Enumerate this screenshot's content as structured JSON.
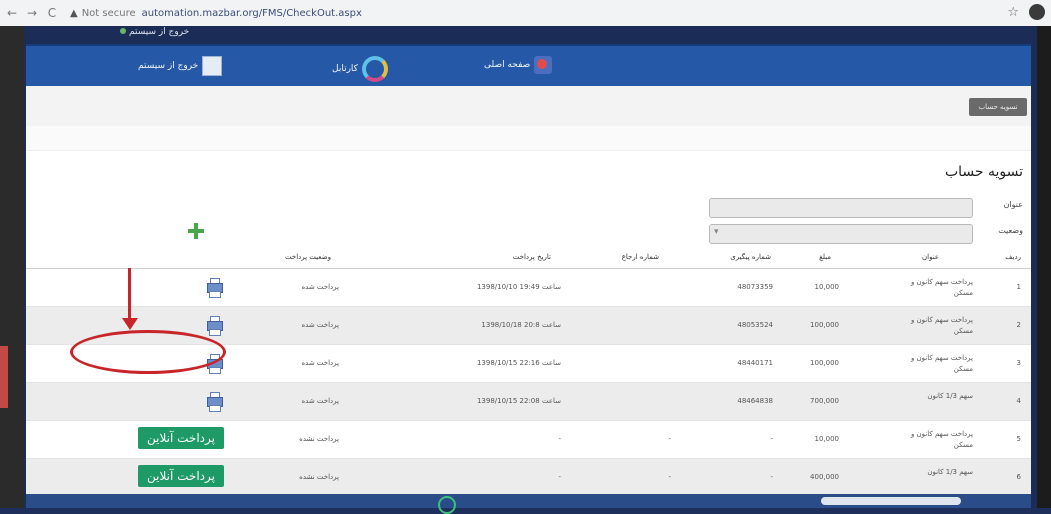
{
  "browser": {
    "back": "←",
    "forward": "→",
    "reload": "C",
    "warning_icon": "▲",
    "not_secure": "Not secure",
    "url": "automation.mazbar.org/FMS/CheckOut.aspx",
    "star": "☆"
  },
  "top_user": "خروج از سیستم",
  "nav": {
    "item_home": "صفحه اصلی",
    "item_cartable": "کارتابل",
    "item_logout": "خروج از سیستم"
  },
  "sub_tab": "تسویه حساب",
  "page_title": "تسویه حساب",
  "filters": {
    "label_title": "عنوان",
    "label_status": "وضعیت",
    "status_marker": "▾"
  },
  "table": {
    "headers": {
      "idx": "ردیف",
      "title": "عنوان",
      "amount": "مبلغ",
      "tracking": "شماره پیگیری",
      "payment_no": "شماره ارجاع",
      "date": "تاریخ پرداخت",
      "state": "وضعیت پرداخت"
    },
    "rows": [
      {
        "idx": "1",
        "title": "پرداخت سهم کانون و مسکن",
        "amount": "10,000",
        "tracking": "48073359",
        "payment_no": "",
        "date": "1398/10/10 ساعت 19:49",
        "state": "پرداخت شده",
        "action": "print"
      },
      {
        "idx": "2",
        "title": "پرداخت سهم کانون و مسکن",
        "amount": "100,000",
        "tracking": "48053524",
        "payment_no": "",
        "date": "1398/10/18 ساعت 20:8",
        "state": "پرداخت شده",
        "action": "print"
      },
      {
        "idx": "3",
        "title": "پرداخت سهم کانون و مسکن",
        "amount": "100,000",
        "tracking": "48440171",
        "payment_no": "",
        "date": "1398/10/15 ساعت 22:16",
        "state": "پرداخت شده",
        "action": "print"
      },
      {
        "idx": "4",
        "title": "سهم 1/3 کانون",
        "amount": "700,000",
        "tracking": "48464838",
        "payment_no": "",
        "date": "1398/10/15 ساعت 22:08",
        "state": "پرداخت شده",
        "action": "print"
      },
      {
        "idx": "5",
        "title": "پرداخت سهم کانون و مسکن",
        "amount": "10,000",
        "tracking": "-",
        "payment_no": "-",
        "date": "-",
        "state": "پرداخت نشده",
        "action": "pay"
      },
      {
        "idx": "6",
        "title": "سهم 1/3 کانون",
        "amount": "400,000",
        "tracking": "-",
        "payment_no": "-",
        "date": "-",
        "state": "پرداخت نشده",
        "action": "pay"
      }
    ],
    "pay_label": "پرداخت آنلاین"
  },
  "colors": {
    "nav_blue": "#2558a6",
    "pay_green": "#1e9a66",
    "annotation_red": "#c8252a"
  }
}
